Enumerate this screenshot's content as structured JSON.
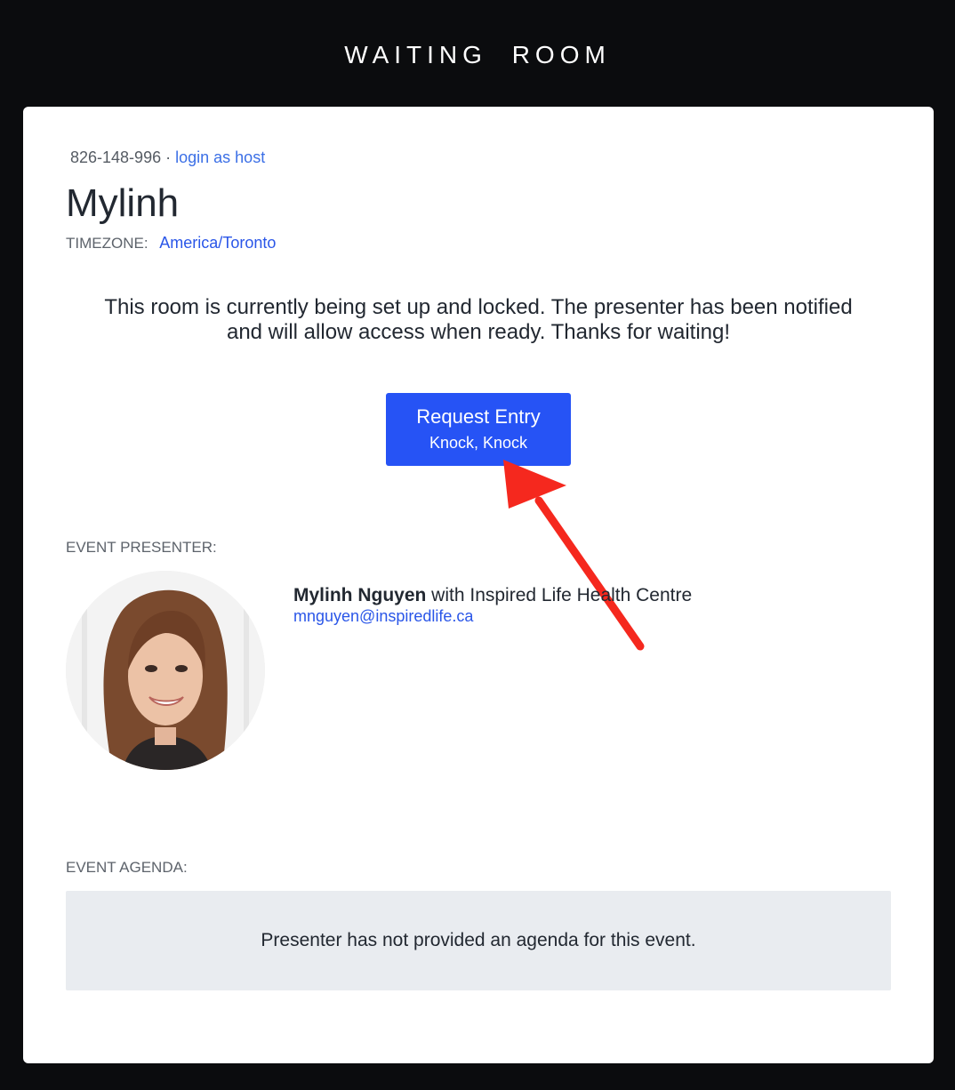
{
  "header": {
    "title": "WAITING ROOM"
  },
  "room": {
    "id": "826-148-996",
    "separator": "·",
    "login_link": "login as host",
    "name": "Mylinh",
    "timezone_label": "TIMEZONE:",
    "timezone_value": "America/Toronto",
    "notice": "This room is currently being set up and locked. The presenter has been notified and will allow access when ready. Thanks for waiting!"
  },
  "request_button": {
    "label": "Request Entry",
    "sublabel": "Knock, Knock",
    "color": "#2653f5"
  },
  "annotation": {
    "arrow_color": "#f5281e"
  },
  "presenter": {
    "section_label": "EVENT PRESENTER:",
    "name": "Mylinh Nguyen",
    "affiliation": " with Inspired Life Health Centre",
    "email": "mnguyen@inspiredlife.ca"
  },
  "agenda": {
    "section_label": "EVENT AGENDA:",
    "empty_text": "Presenter has not provided an agenda for this event."
  }
}
